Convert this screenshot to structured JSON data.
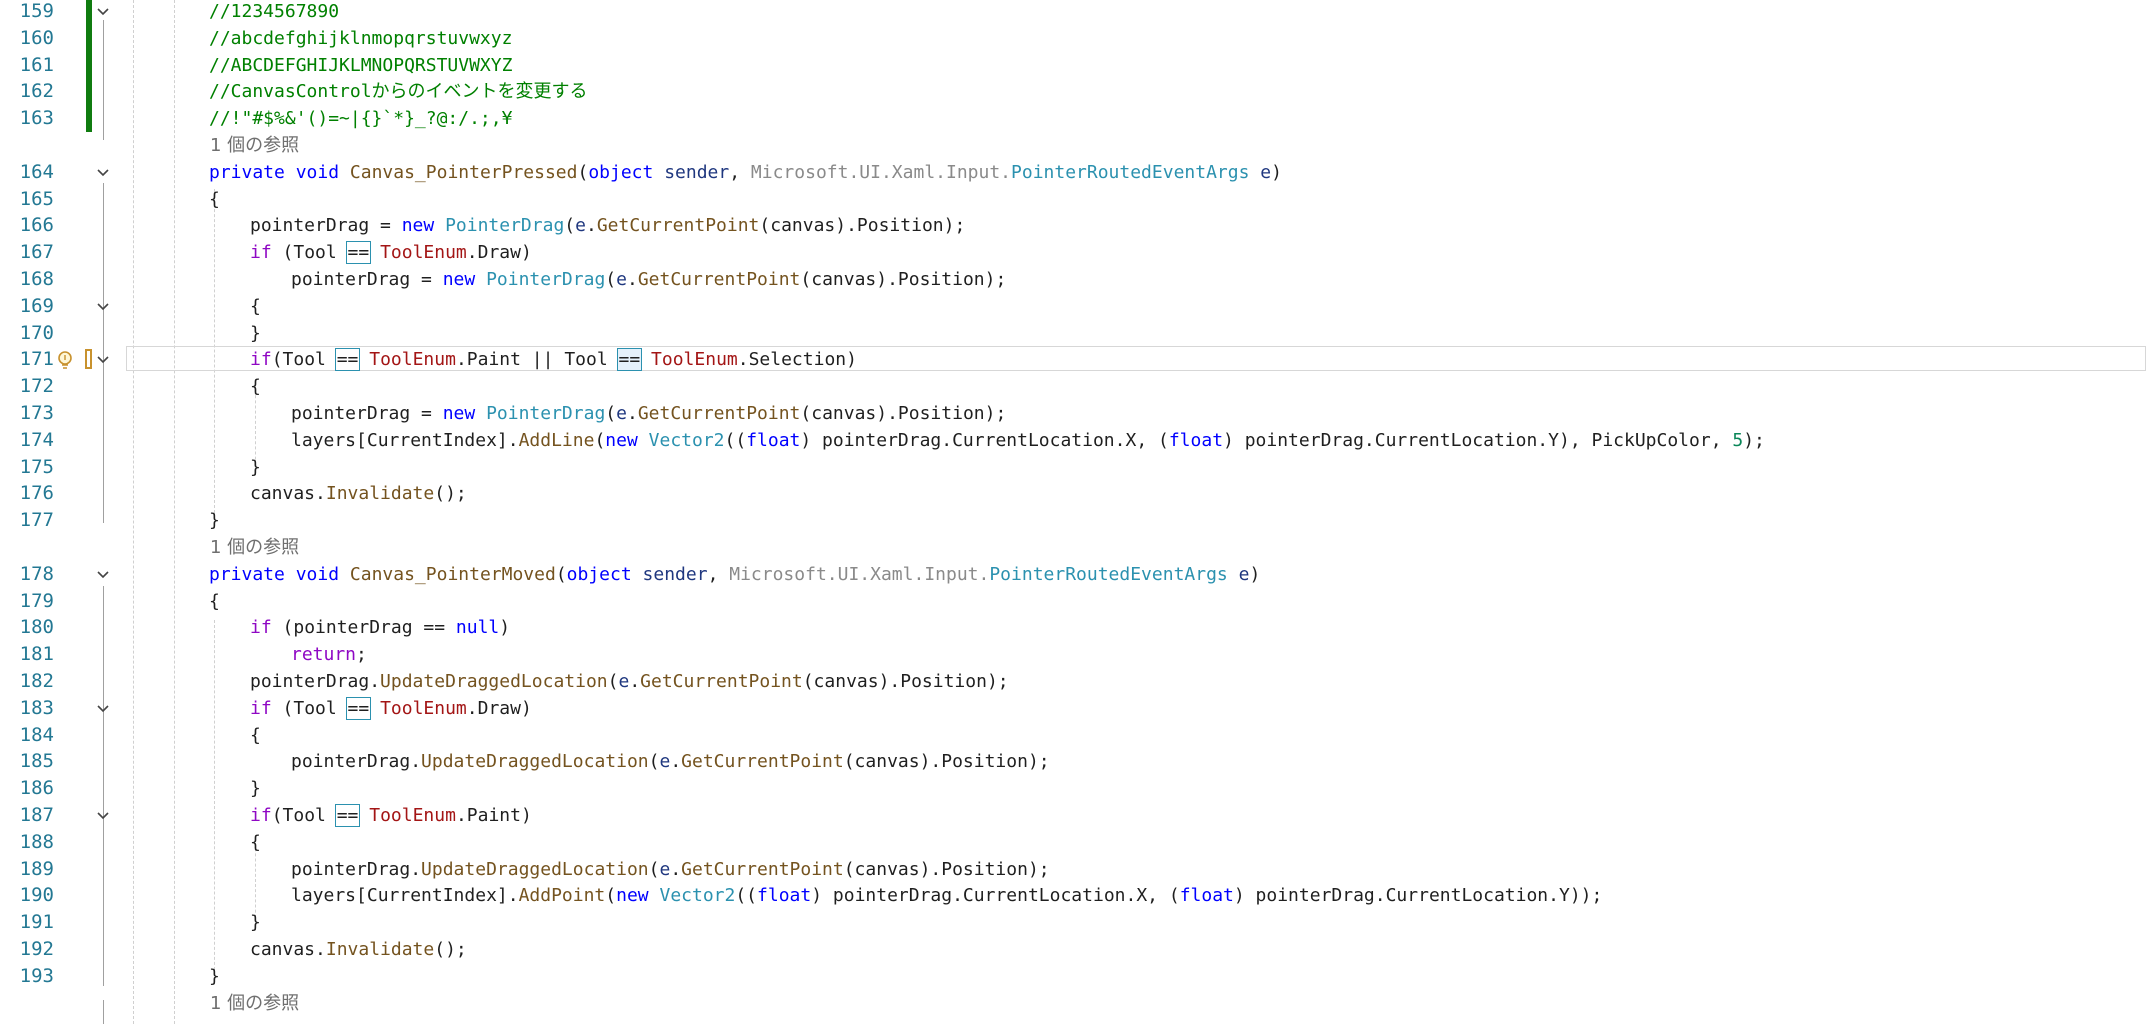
{
  "editor": {
    "lines": [
      {
        "num": "159",
        "type": "comment",
        "indent": 0,
        "text": "//1234567890",
        "bar": true,
        "fold": "open"
      },
      {
        "num": "160",
        "type": "comment",
        "indent": 0,
        "text": "//abcdefghijklnmopqrstuvwxyz",
        "bar": true
      },
      {
        "num": "161",
        "type": "comment",
        "indent": 0,
        "text": "//ABCDEFGHIJKLMNOPQRSTUVWXYZ",
        "bar": true
      },
      {
        "num": "162",
        "type": "comment",
        "indent": 0,
        "text": "//CanvasControlからのイベントを変更する",
        "bar": true
      },
      {
        "num": "163",
        "type": "comment",
        "indent": 0,
        "text": "//!\"#$%&'()=~|{}`*}_?@:/.;,¥",
        "bar": true
      },
      {
        "type": "ref",
        "text": "1 個の参照"
      },
      {
        "num": "164",
        "fold": "open",
        "indent": 0,
        "tokens": [
          [
            "k",
            "private"
          ],
          [
            "",
            " "
          ],
          [
            "k",
            "void"
          ],
          [
            "",
            " "
          ],
          [
            "m",
            "Canvas_PointerPressed"
          ],
          [
            "",
            "("
          ],
          [
            "k",
            "object"
          ],
          [
            "",
            " "
          ],
          [
            "p",
            "sender"
          ],
          [
            "",
            ", "
          ],
          [
            "g",
            "Microsoft.UI.Xaml.Input."
          ],
          [
            "t",
            "PointerRoutedEventArgs"
          ],
          [
            "",
            " "
          ],
          [
            "p",
            "e"
          ],
          [
            "",
            ")"
          ]
        ]
      },
      {
        "num": "165",
        "indent": 0,
        "tokens": [
          [
            "",
            "{"
          ]
        ]
      },
      {
        "num": "166",
        "indent": 1,
        "tokens": [
          [
            "",
            "pointerDrag = "
          ],
          [
            "k",
            "new"
          ],
          [
            "",
            " "
          ],
          [
            "t",
            "PointerDrag"
          ],
          [
            "",
            "("
          ],
          [
            "p",
            "e"
          ],
          [
            "",
            "."
          ],
          [
            "m",
            "GetCurrentPoint"
          ],
          [
            "",
            "(canvas).Position);"
          ]
        ]
      },
      {
        "num": "167",
        "indent": 1,
        "tokens": [
          [
            "kc",
            "if"
          ],
          [
            "",
            " (Tool "
          ],
          [
            "hl",
            "=="
          ],
          [
            "",
            " "
          ],
          [
            "e",
            "ToolEnum"
          ],
          [
            "",
            ".Draw)"
          ]
        ]
      },
      {
        "num": "168",
        "indent": 2,
        "tokens": [
          [
            "",
            "pointerDrag = "
          ],
          [
            "k",
            "new"
          ],
          [
            "",
            " "
          ],
          [
            "t",
            "PointerDrag"
          ],
          [
            "",
            "("
          ],
          [
            "p",
            "e"
          ],
          [
            "",
            "."
          ],
          [
            "m",
            "GetCurrentPoint"
          ],
          [
            "",
            "(canvas).Position);"
          ]
        ]
      },
      {
        "num": "169",
        "fold": "open",
        "indent": 1,
        "tokens": [
          [
            "",
            "{"
          ]
        ]
      },
      {
        "num": "170",
        "indent": 1,
        "tokens": [
          [
            "",
            "}"
          ]
        ]
      },
      {
        "num": "171",
        "fold": "open",
        "current": true,
        "bulb": true,
        "indent": 1,
        "tokens": [
          [
            "kc",
            "if"
          ],
          [
            "",
            "(Tool "
          ],
          [
            "hl",
            "=="
          ],
          [
            "",
            " "
          ],
          [
            "e",
            "ToolEnum"
          ],
          [
            "",
            ".Paint || Tool "
          ],
          [
            "hl2",
            "=="
          ],
          [
            "",
            " "
          ],
          [
            "e",
            "ToolEnum"
          ],
          [
            "",
            ".Selection)"
          ]
        ]
      },
      {
        "num": "172",
        "indent": 1,
        "tokens": [
          [
            "",
            "{"
          ]
        ]
      },
      {
        "num": "173",
        "indent": 2,
        "tokens": [
          [
            "",
            "pointerDrag = "
          ],
          [
            "k",
            "new"
          ],
          [
            "",
            " "
          ],
          [
            "t",
            "PointerDrag"
          ],
          [
            "",
            "("
          ],
          [
            "p",
            "e"
          ],
          [
            "",
            "."
          ],
          [
            "m",
            "GetCurrentPoint"
          ],
          [
            "",
            "(canvas).Position);"
          ]
        ]
      },
      {
        "num": "174",
        "indent": 2,
        "tokens": [
          [
            "",
            "layers[CurrentIndex]."
          ],
          [
            "m",
            "AddLine"
          ],
          [
            "",
            "("
          ],
          [
            "k",
            "new"
          ],
          [
            "",
            " "
          ],
          [
            "t",
            "Vector2"
          ],
          [
            "",
            "(("
          ],
          [
            "k",
            "float"
          ],
          [
            "",
            ") pointerDrag.CurrentLocation.X, ("
          ],
          [
            "k",
            "float"
          ],
          [
            "",
            ") pointerDrag.CurrentLocation.Y), PickUpColor, "
          ],
          [
            "n",
            "5"
          ],
          [
            "",
            ");"
          ]
        ]
      },
      {
        "num": "175",
        "indent": 1,
        "tokens": [
          [
            "",
            "}"
          ]
        ]
      },
      {
        "num": "176",
        "indent": 1,
        "tokens": [
          [
            "",
            "canvas."
          ],
          [
            "m",
            "Invalidate"
          ],
          [
            "",
            "();"
          ]
        ]
      },
      {
        "num": "177",
        "indent": 0,
        "tokens": [
          [
            "",
            "}"
          ]
        ]
      },
      {
        "type": "ref",
        "text": "1 個の参照"
      },
      {
        "num": "178",
        "fold": "open",
        "indent": 0,
        "tokens": [
          [
            "k",
            "private"
          ],
          [
            "",
            " "
          ],
          [
            "k",
            "void"
          ],
          [
            "",
            " "
          ],
          [
            "m",
            "Canvas_PointerMoved"
          ],
          [
            "",
            "("
          ],
          [
            "k",
            "object"
          ],
          [
            "",
            " "
          ],
          [
            "p",
            "sender"
          ],
          [
            "",
            ", "
          ],
          [
            "g",
            "Microsoft.UI.Xaml.Input."
          ],
          [
            "t",
            "PointerRoutedEventArgs"
          ],
          [
            "",
            " "
          ],
          [
            "p",
            "e"
          ],
          [
            "",
            ")"
          ]
        ]
      },
      {
        "num": "179",
        "indent": 0,
        "tokens": [
          [
            "",
            "{"
          ]
        ]
      },
      {
        "num": "180",
        "indent": 1,
        "tokens": [
          [
            "kc",
            "if"
          ],
          [
            "",
            " (pointerDrag == "
          ],
          [
            "k",
            "null"
          ],
          [
            "",
            ")"
          ]
        ]
      },
      {
        "num": "181",
        "indent": 2,
        "tokens": [
          [
            "kc",
            "return"
          ],
          [
            "",
            ";"
          ]
        ]
      },
      {
        "num": "182",
        "indent": 1,
        "tokens": [
          [
            "",
            "pointerDrag."
          ],
          [
            "m",
            "UpdateDraggedLocation"
          ],
          [
            "",
            "("
          ],
          [
            "p",
            "e"
          ],
          [
            "",
            "."
          ],
          [
            "m",
            "GetCurrentPoint"
          ],
          [
            "",
            "(canvas).Position);"
          ]
        ]
      },
      {
        "num": "183",
        "fold": "open",
        "indent": 1,
        "tokens": [
          [
            "kc",
            "if"
          ],
          [
            "",
            " (Tool "
          ],
          [
            "hl",
            "=="
          ],
          [
            "",
            " "
          ],
          [
            "e",
            "ToolEnum"
          ],
          [
            "",
            ".Draw)"
          ]
        ]
      },
      {
        "num": "184",
        "indent": 1,
        "tokens": [
          [
            "",
            "{"
          ]
        ]
      },
      {
        "num": "185",
        "indent": 2,
        "tokens": [
          [
            "",
            "pointerDrag."
          ],
          [
            "m",
            "UpdateDraggedLocation"
          ],
          [
            "",
            "("
          ],
          [
            "p",
            "e"
          ],
          [
            "",
            "."
          ],
          [
            "m",
            "GetCurrentPoint"
          ],
          [
            "",
            "(canvas).Position);"
          ]
        ]
      },
      {
        "num": "186",
        "indent": 1,
        "tokens": [
          [
            "",
            "}"
          ]
        ]
      },
      {
        "num": "187",
        "fold": "open",
        "indent": 1,
        "tokens": [
          [
            "kc",
            "if"
          ],
          [
            "",
            "(Tool "
          ],
          [
            "hl",
            "=="
          ],
          [
            "",
            " "
          ],
          [
            "e",
            "ToolEnum"
          ],
          [
            "",
            ".Paint)"
          ]
        ]
      },
      {
        "num": "188",
        "indent": 1,
        "tokens": [
          [
            "",
            "{"
          ]
        ]
      },
      {
        "num": "189",
        "indent": 2,
        "tokens": [
          [
            "",
            "pointerDrag."
          ],
          [
            "m",
            "UpdateDraggedLocation"
          ],
          [
            "",
            "("
          ],
          [
            "p",
            "e"
          ],
          [
            "",
            "."
          ],
          [
            "m",
            "GetCurrentPoint"
          ],
          [
            "",
            "(canvas).Position);"
          ]
        ]
      },
      {
        "num": "190",
        "indent": 2,
        "tokens": [
          [
            "",
            "layers[CurrentIndex]."
          ],
          [
            "m",
            "AddPoint"
          ],
          [
            "",
            "("
          ],
          [
            "k",
            "new"
          ],
          [
            "",
            " "
          ],
          [
            "t",
            "Vector2"
          ],
          [
            "",
            "(("
          ],
          [
            "k",
            "float"
          ],
          [
            "",
            ") pointerDrag.CurrentLocation.X, ("
          ],
          [
            "k",
            "float"
          ],
          [
            "",
            ") pointerDrag.CurrentLocation.Y));"
          ]
        ]
      },
      {
        "num": "191",
        "indent": 1,
        "tokens": [
          [
            "",
            "}"
          ]
        ]
      },
      {
        "num": "192",
        "indent": 1,
        "tokens": [
          [
            "",
            "canvas."
          ],
          [
            "m",
            "Invalidate"
          ],
          [
            "",
            "();"
          ]
        ]
      },
      {
        "num": "193",
        "indent": 0,
        "tokens": [
          [
            "",
            "}"
          ]
        ]
      },
      {
        "type": "ref",
        "text": "1 個の参照"
      }
    ]
  }
}
